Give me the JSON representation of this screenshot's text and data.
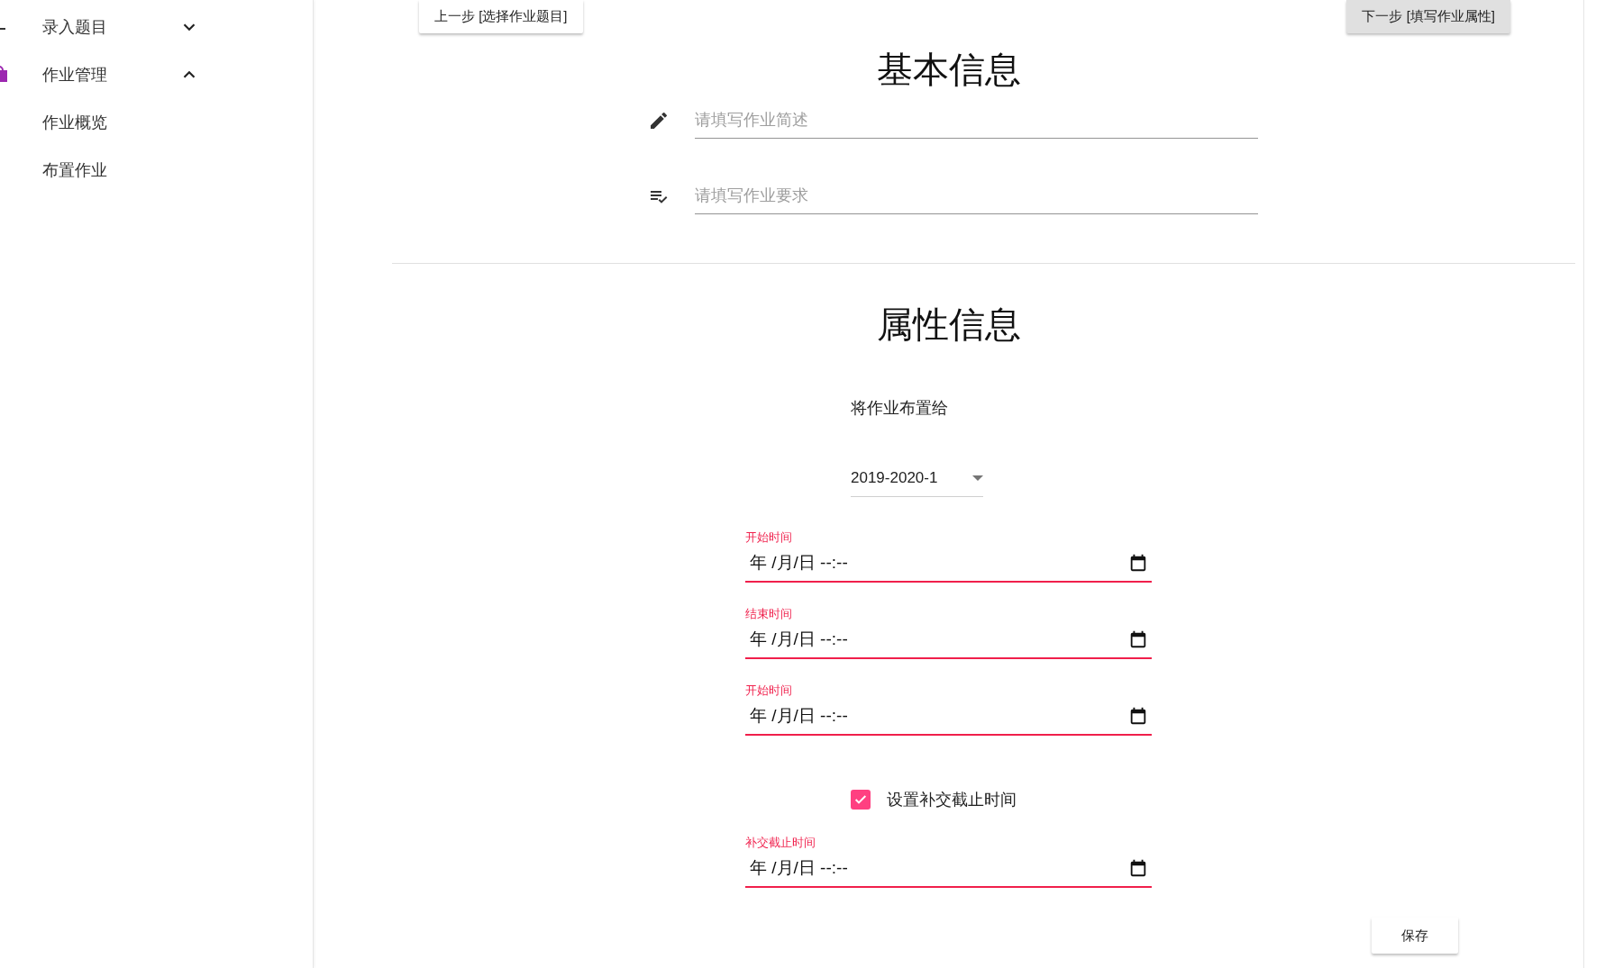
{
  "sidebar": {
    "items": [
      {
        "label": "录入题目",
        "expanded": false
      },
      {
        "label": "作业管理",
        "expanded": true,
        "children": [
          {
            "label": "作业概览"
          },
          {
            "label": "布置作业"
          }
        ]
      }
    ]
  },
  "toolbar": {
    "prev_button": "上一步 [选择作业题目]",
    "next_button": "下一步 [填写作业属性]"
  },
  "basic_info": {
    "title": "基本信息",
    "fields": [
      {
        "kind": "edit",
        "placeholder": "请填写作业简述"
      },
      {
        "kind": "checklist",
        "placeholder": "请填写作业要求"
      }
    ]
  },
  "attributes": {
    "title": "属性信息",
    "assign_label": "将作业布置给",
    "select": {
      "value": "2019-2020-1"
    },
    "date_fields": [
      {
        "label": "开始时间",
        "value": "年 /月/日 --:--",
        "invalid": true
      },
      {
        "label": "结束时间",
        "value": "年 /月/日 --:--",
        "invalid": true
      },
      {
        "label": "开始时间",
        "value": "年 /月/日 --:--",
        "invalid": true
      }
    ],
    "checkbox": {
      "label": "设置补交截止时间",
      "checked": true
    },
    "makeup_field": {
      "label": "补交截止时间",
      "value": "年 /月/日 --:--",
      "invalid": true
    },
    "save_button": "保存"
  }
}
